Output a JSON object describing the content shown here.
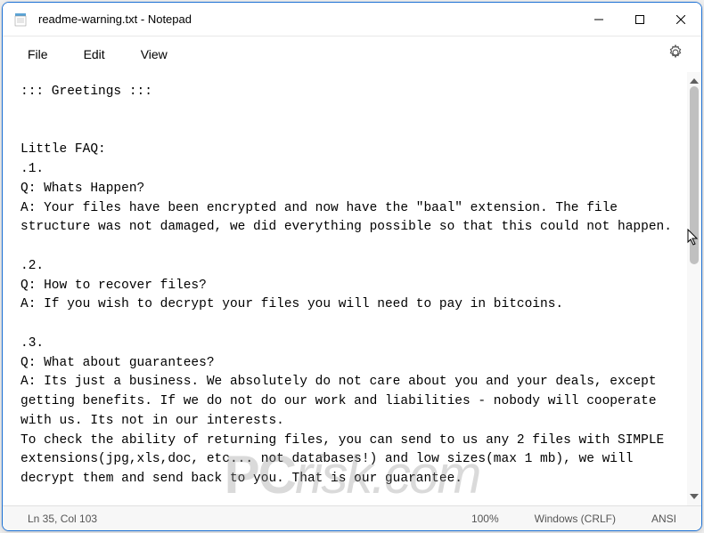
{
  "window": {
    "title": "readme-warning.txt - Notepad"
  },
  "menu": {
    "file": "File",
    "edit": "Edit",
    "view": "View"
  },
  "content": {
    "text": "::: Greetings :::\n\n\nLittle FAQ:\n.1.\nQ: Whats Happen?\nA: Your files have been encrypted and now have the \"baal\" extension. The file structure was not damaged, we did everything possible so that this could not happen.\n\n.2.\nQ: How to recover files?\nA: If you wish to decrypt your files you will need to pay in bitcoins.\n\n.3.\nQ: What about guarantees?\nA: Its just a business. We absolutely do not care about you and your deals, except getting benefits. If we do not do our work and liabilities - nobody will cooperate with us. Its not in our interests.\nTo check the ability of returning files, you can send to us any 2 files with SIMPLE extensions(jpg,xls,doc, etc... not databases!) and low sizes(max 1 mb), we will decrypt them and send back to you. That is our guarantee."
  },
  "statusbar": {
    "position": "Ln 35, Col 103",
    "zoom": "100%",
    "lineending": "Windows (CRLF)",
    "encoding": "ANSI"
  },
  "watermark": {
    "pc": "PC",
    "rest": "risk.com"
  }
}
